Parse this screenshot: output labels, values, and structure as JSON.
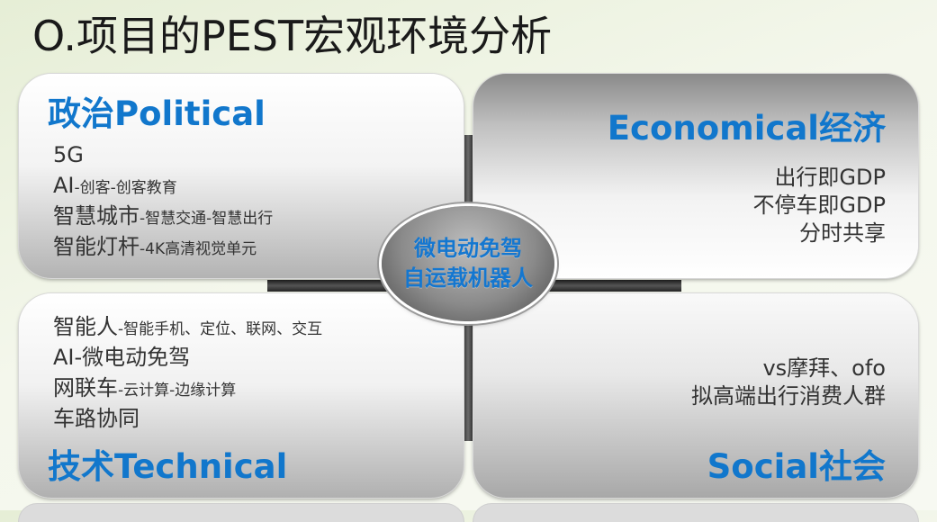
{
  "title": "O.项目的PEST宏观环境分析",
  "center": {
    "line1": "微电动免驾",
    "line2": "自运载机器人"
  },
  "political": {
    "title": "政治Political",
    "items": [
      {
        "main": "5G",
        "sub": ""
      },
      {
        "main": "AI",
        "sub": "-创客-创客教育"
      },
      {
        "main": "智慧城市",
        "sub": "-智慧交通-智慧出行"
      },
      {
        "main": "智能灯杆",
        "sub": "-4K高清视觉单元"
      }
    ]
  },
  "economical": {
    "title": "Economical经济",
    "items": [
      "出行即GDP",
      "不停车即GDP",
      "分时共享"
    ]
  },
  "technical": {
    "title": "技术Technical",
    "items": [
      {
        "main": "智能人",
        "sub": "-智能手机、定位、联网、交互"
      },
      {
        "main": "AI-微电动免驾",
        "sub": ""
      },
      {
        "main": "网联车",
        "sub": "-云计算-边缘计算"
      },
      {
        "main": "车路协同",
        "sub": ""
      }
    ]
  },
  "social": {
    "title": "Social社会",
    "items": [
      "vs摩拜、ofo",
      "拟高端出行消费人群"
    ]
  },
  "colors": {
    "accent": "#1177cc",
    "text": "#333333"
  }
}
